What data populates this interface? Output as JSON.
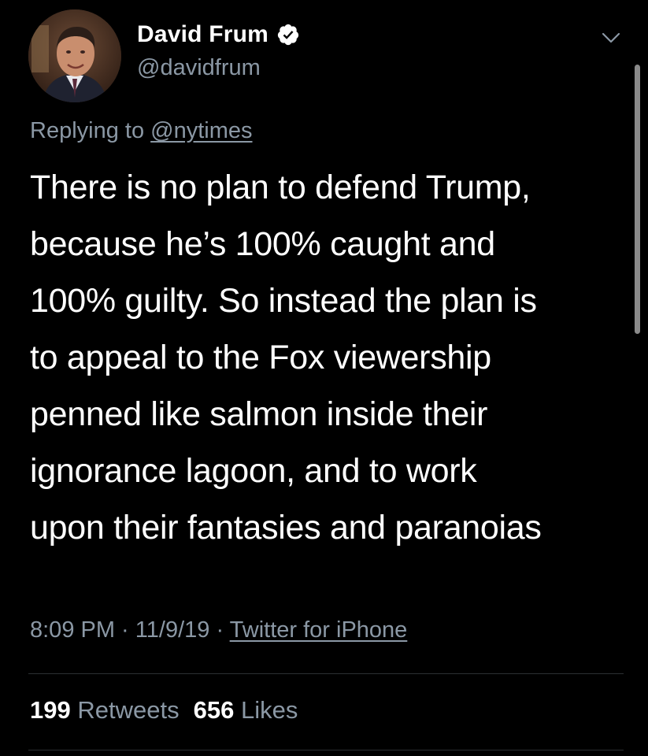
{
  "author": {
    "display_name": "David Frum",
    "handle": "@davidfrum",
    "verified": true
  },
  "reply": {
    "prefix": "Replying to",
    "mention": "@nytimes"
  },
  "tweet": {
    "lines": [
      "There is no plan to defend Trump,",
      "because he’s 100% caught and",
      "100% guilty. So instead the plan is",
      "to appeal to the Fox viewership",
      "penned like salmon inside their",
      "ignorance lagoon, and to work",
      "upon their fantasies and paranoias"
    ]
  },
  "meta": {
    "time": "8:09 PM",
    "separator": " · ",
    "date": "11/9/19",
    "source": "Twitter for iPhone"
  },
  "stats": {
    "retweets_count": "199",
    "retweets_label": "Retweets",
    "likes_count": "656",
    "likes_label": "Likes"
  },
  "icons": {
    "verified": "verified-badge-icon",
    "menu": "chevron-down-icon"
  },
  "colors": {
    "background": "#000000",
    "text_primary": "#ffffff",
    "text_secondary": "#8b98a5",
    "divider": "#2b2f33"
  }
}
